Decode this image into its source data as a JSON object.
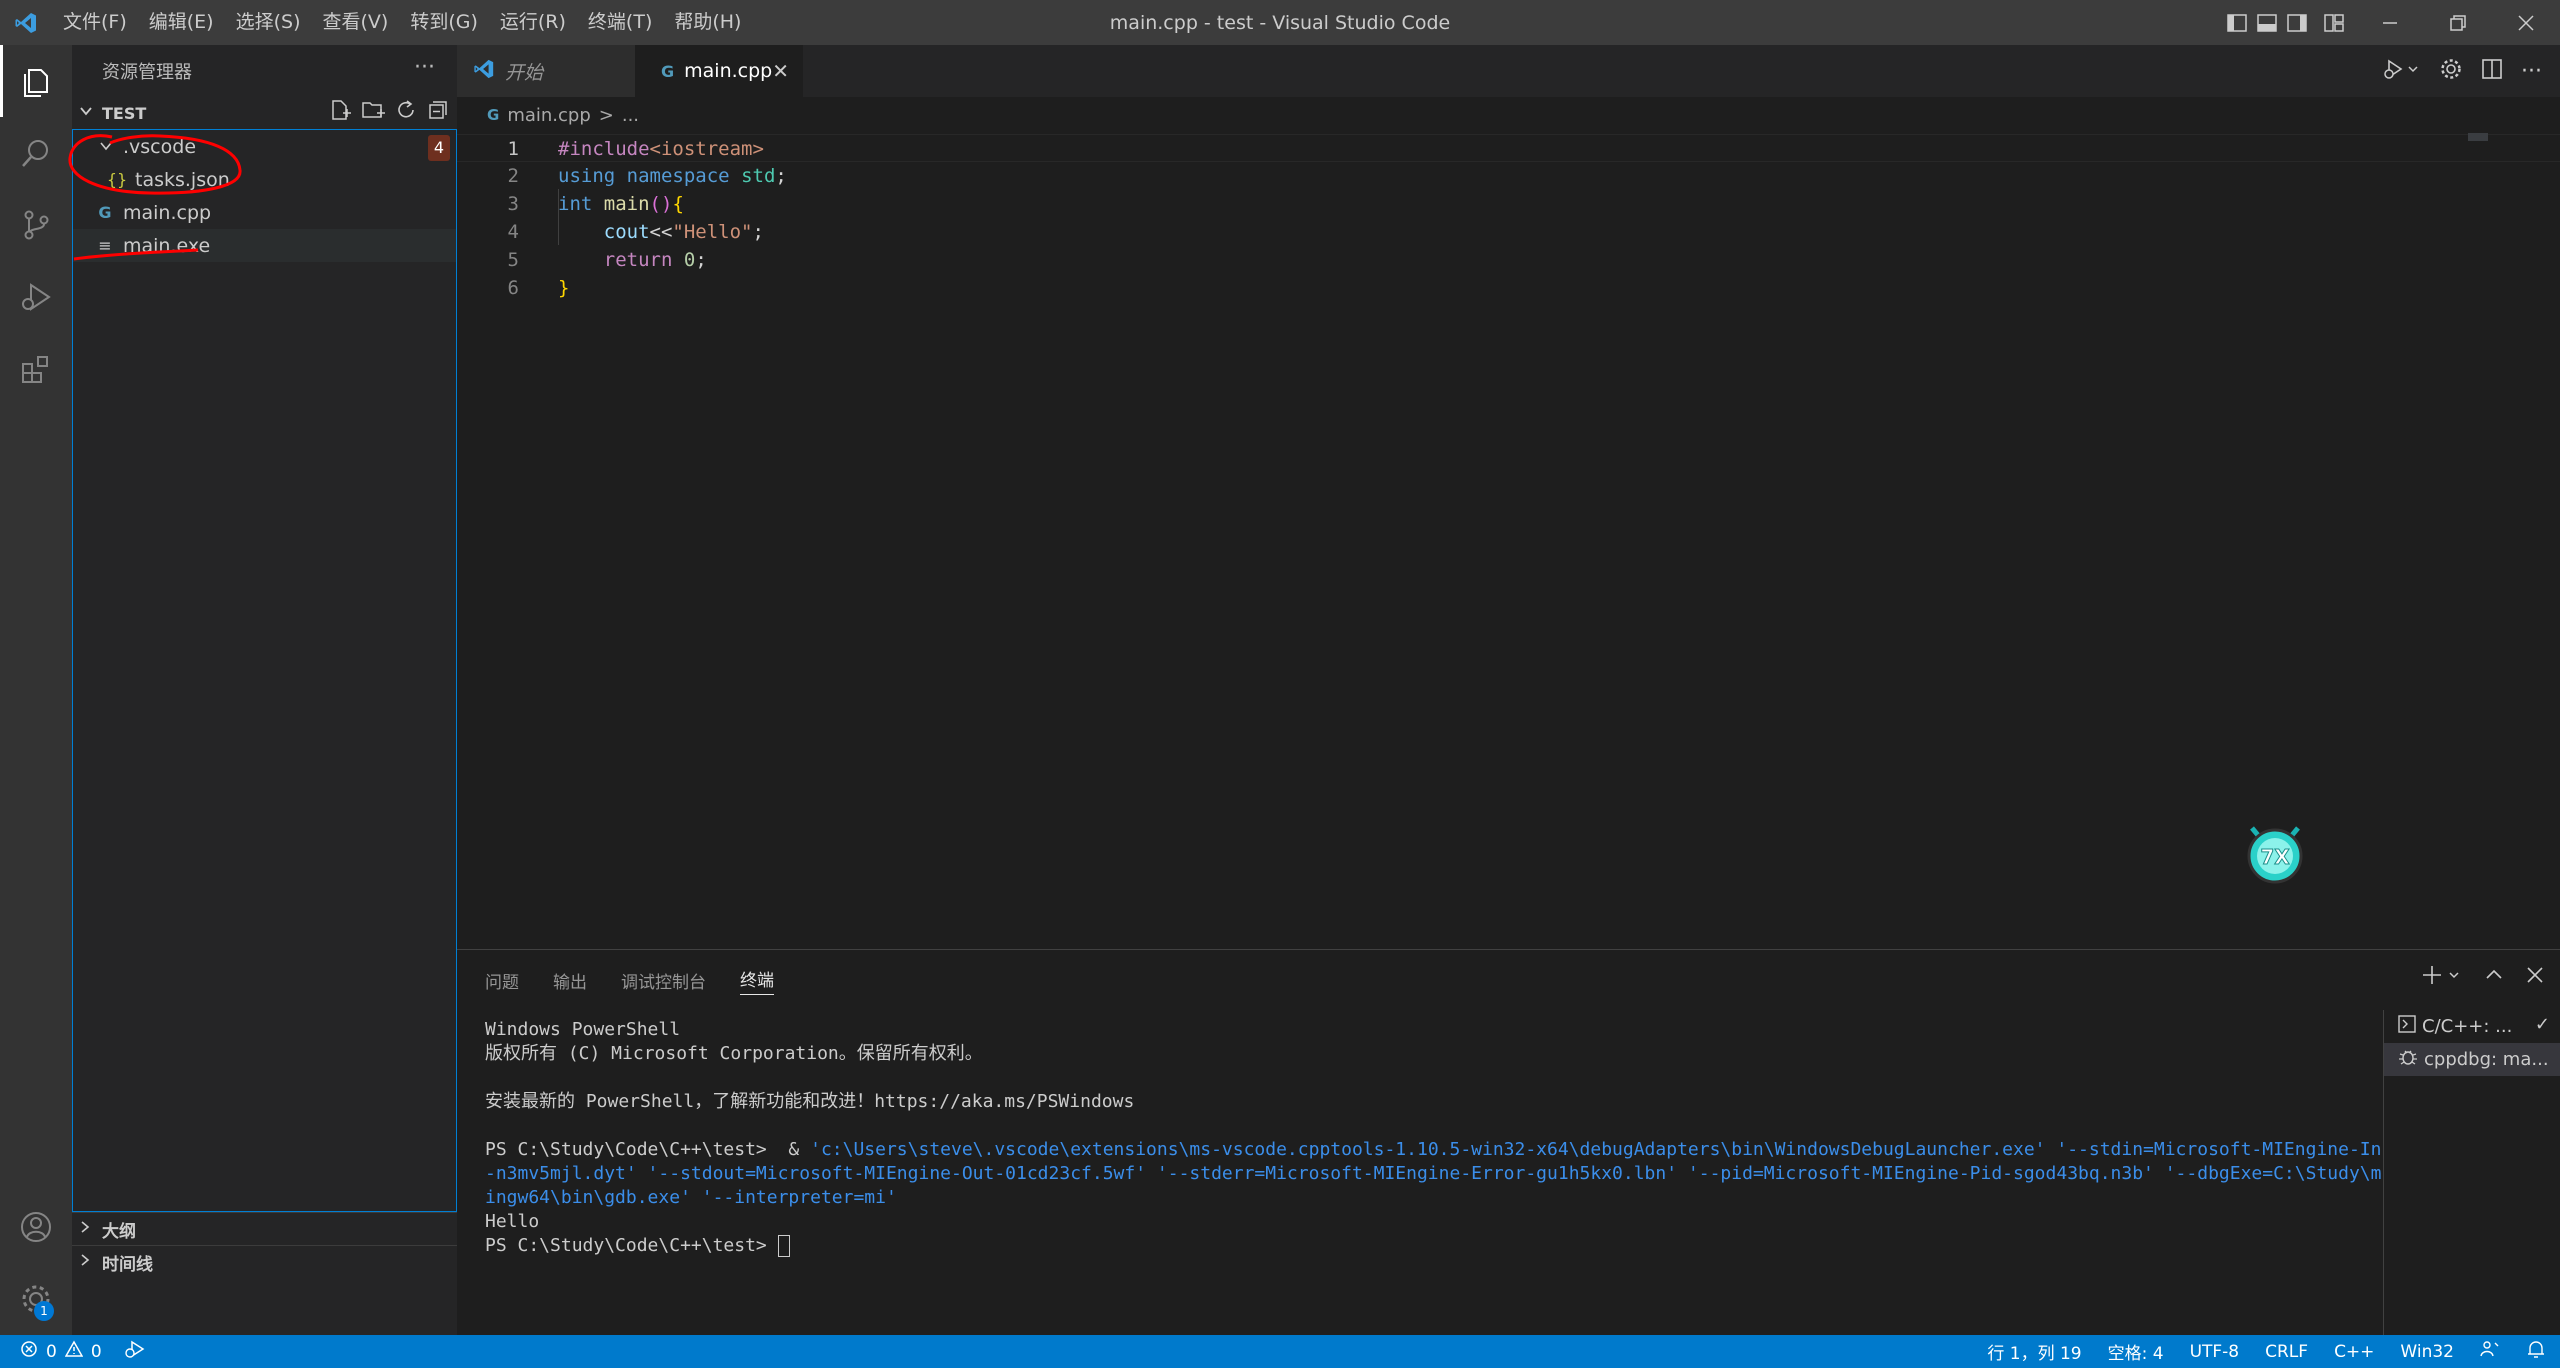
{
  "titlebar": {
    "menus": [
      "文件(F)",
      "编辑(E)",
      "选择(S)",
      "查看(V)",
      "转到(G)",
      "运行(R)",
      "终端(T)",
      "帮助(H)"
    ],
    "window_title": "main.cpp - test - Visual Studio Code"
  },
  "sidebar": {
    "title": "资源管理器",
    "more": "···",
    "section": "TEST",
    "tree": [
      {
        "label": ".vscode",
        "type": "folder",
        "expanded": true,
        "error_count": "4"
      },
      {
        "label": "tasks.json",
        "type": "json",
        "icon": "{}"
      },
      {
        "label": "main.cpp",
        "type": "cpp",
        "icon": "G"
      },
      {
        "label": "main.exe",
        "type": "file",
        "icon": "≡"
      }
    ],
    "outline": "大纲",
    "timeline": "时间线"
  },
  "tabs": [
    {
      "label": "开始",
      "active": false
    },
    {
      "label": "main.cpp",
      "active": true
    }
  ],
  "breadcrumb": {
    "file": "main.cpp",
    "sep": ">",
    "rest": "..."
  },
  "editor": {
    "line_numbers": [
      "1",
      "2",
      "3",
      "4",
      "5",
      "6"
    ],
    "lines": [
      {
        "t1": "#include",
        "t2": "<iostream>"
      },
      {
        "t1": "using",
        "t2": "namespace",
        "t3": "std",
        "t4": ";"
      },
      {
        "t1": "int",
        "t2": "main",
        "t3": "()",
        "t4": "{"
      },
      {
        "t1": "cout",
        "t2": "<<",
        "t3": "\"Hello\"",
        "t4": ";"
      },
      {
        "t1": "return",
        "t2": "0",
        "t3": ";"
      },
      {
        "t1": "}"
      }
    ]
  },
  "panel": {
    "tabs": [
      "问题",
      "输出",
      "调试控制台",
      "终端"
    ],
    "active_tab": "终端",
    "terminal": {
      "l1": "Windows PowerShell",
      "l2": "版权所有 (C) Microsoft Corporation。保留所有权利。",
      "l3": "安装最新的 PowerShell，了解新功能和改进！https://aka.ms/PSWindows",
      "prompt1": "PS C:\\Study\\Code\\C++\\test>  & ",
      "cmd": "'c:\\Users\\steve\\.vscode\\extensions\\ms-vscode.cpptools-1.10.5-win32-x64\\debugAdapters\\bin\\WindowsDebugLauncher.exe' '--stdin=Microsoft-MIEngine-In-n3mv5mjl.dyt' '--stdout=Microsoft-MIEngine-Out-01cd23cf.5wf' '--stderr=Microsoft-MIEngine-Error-gu1h5kx0.lbn' '--pid=Microsoft-MIEngine-Pid-sgod43bq.n3b' '--dbgExe=C:\\Study\\mingw64\\bin\\gdb.exe' '--interpreter=mi'",
      "output": "Hello",
      "prompt2": "PS C:\\Study\\Code\\C++\\test> "
    },
    "terminals": [
      "C/C++: ...",
      "cppdbg: ma..."
    ]
  },
  "statusbar": {
    "errors": "0",
    "warnings": "0",
    "position": "行 1，列 19",
    "spaces": "空格: 4",
    "encoding": "UTF-8",
    "eol": "CRLF",
    "language": "C++",
    "platform": "Win32"
  },
  "colors": {
    "accent": "#007acc",
    "annotation": "#ff0000"
  }
}
